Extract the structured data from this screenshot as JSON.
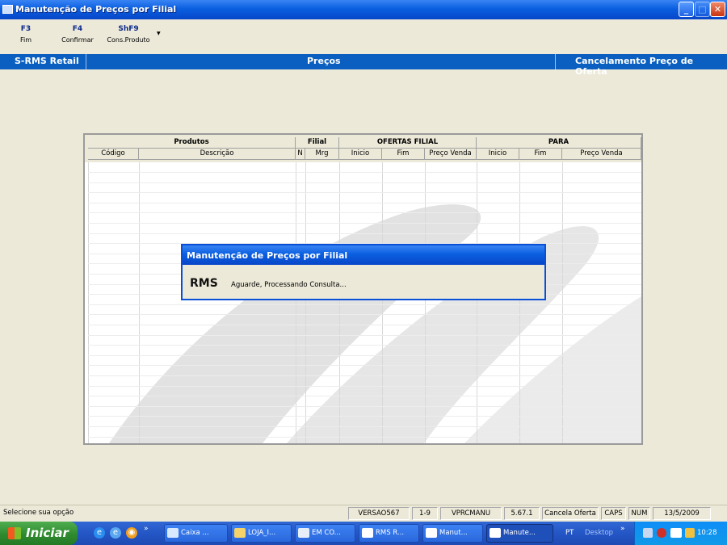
{
  "window": {
    "title": "Manutenção de Preços por Filial"
  },
  "function_keys": [
    {
      "key": "F3",
      "label": "Fim"
    },
    {
      "key": "F4",
      "label": "Confirmar"
    },
    {
      "key": "ShF9",
      "label": "Cons.Produto"
    }
  ],
  "header_bar": {
    "left": "S-RMS Retail",
    "center": "Preços",
    "right": "Cancelamento Preço de Oferta"
  },
  "grid": {
    "groups": [
      "Produtos",
      "Filial",
      "OFERTAS FILIAL",
      "PARA"
    ],
    "columns": [
      "Código",
      "Descrição",
      "N",
      "Mrg",
      "Inicio",
      "Fim",
      "Preço Venda",
      "Inicio",
      "Fim",
      "Preço Venda"
    ],
    "rows": []
  },
  "dialog": {
    "title": "Manutenção de Preços por Filial",
    "logo": "RMS",
    "message": "Aguarde, Processando Consulta..."
  },
  "status_bar": [
    "Selecione sua opção",
    "VERSAO567",
    "1-9",
    "VPRCMANU",
    "5.67.1",
    "Cancela Oferta",
    "CAPS",
    "NUM",
    "13/5/2009"
  ],
  "taskbar": {
    "start_label": "Iniciar",
    "items": [
      {
        "label": "Caixa ...",
        "active": false
      },
      {
        "label": "LOJA_I...",
        "active": false
      },
      {
        "label": "EM CO...",
        "active": false
      },
      {
        "label": "RMS R...",
        "active": false
      },
      {
        "label": "Manut...",
        "active": false
      },
      {
        "label": "Manute...",
        "active": true
      }
    ],
    "language": "PT",
    "desktop": "Desktop",
    "clock": "10:28"
  },
  "colors": {
    "title_blue": "#0a5fe0",
    "header_bar_blue": "#0a5fc0",
    "window_bg": "#ece9d8",
    "start_green": "#2f8a2f"
  }
}
